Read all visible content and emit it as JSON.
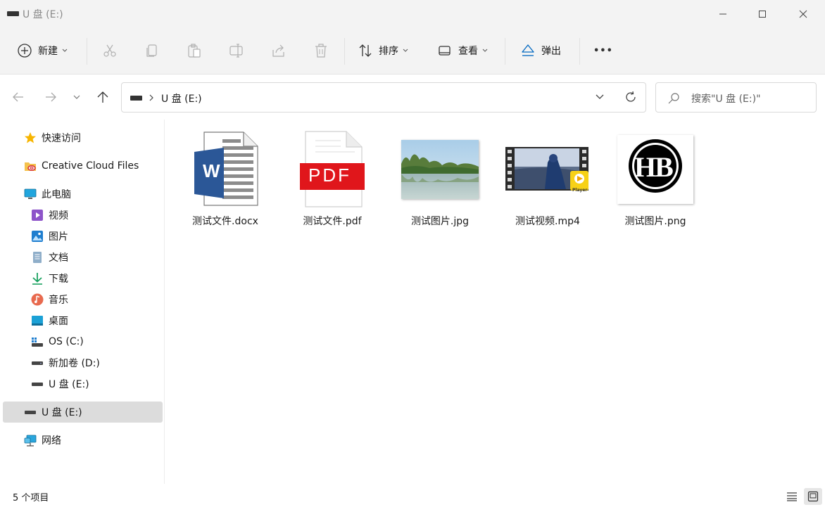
{
  "window": {
    "title": "U 盘 (E:)"
  },
  "ribbon": {
    "new_label": "新建",
    "sort_label": "排序",
    "view_label": "查看",
    "eject_label": "弹出",
    "more_label": "•••"
  },
  "address": {
    "path_text": "U 盘 (E:)",
    "search_placeholder": "搜索\"U 盘 (E:)\""
  },
  "sidebar": {
    "items": [
      {
        "label": "快速访问"
      },
      {
        "label": "Creative Cloud Files"
      },
      {
        "label": "此电脑"
      },
      {
        "label": "视频"
      },
      {
        "label": "图片"
      },
      {
        "label": "文档"
      },
      {
        "label": "下载"
      },
      {
        "label": "音乐"
      },
      {
        "label": "桌面"
      },
      {
        "label": "OS (C:)"
      },
      {
        "label": "新加卷 (D:)"
      },
      {
        "label": "U 盘 (E:)"
      },
      {
        "label": "U 盘 (E:)"
      },
      {
        "label": "网络"
      }
    ]
  },
  "files": [
    {
      "name": "测试文件.docx"
    },
    {
      "name": "测试文件.pdf"
    },
    {
      "name": "测试图片.jpg"
    },
    {
      "name": "测试视频.mp4"
    },
    {
      "name": "测试图片.png"
    }
  ],
  "thumbnails": {
    "pdf_text": "PDF",
    "word_letter": "W",
    "png_logo": "HB",
    "player_badge": "Player"
  },
  "status": {
    "count_text": "5 个项目"
  },
  "colors": {
    "chrome_bg": "#f3f3f3",
    "selected_bg": "#dcdcdc",
    "word_blue": "#2b5797",
    "pdf_red": "#e0161b",
    "accent": "#0067c0"
  }
}
